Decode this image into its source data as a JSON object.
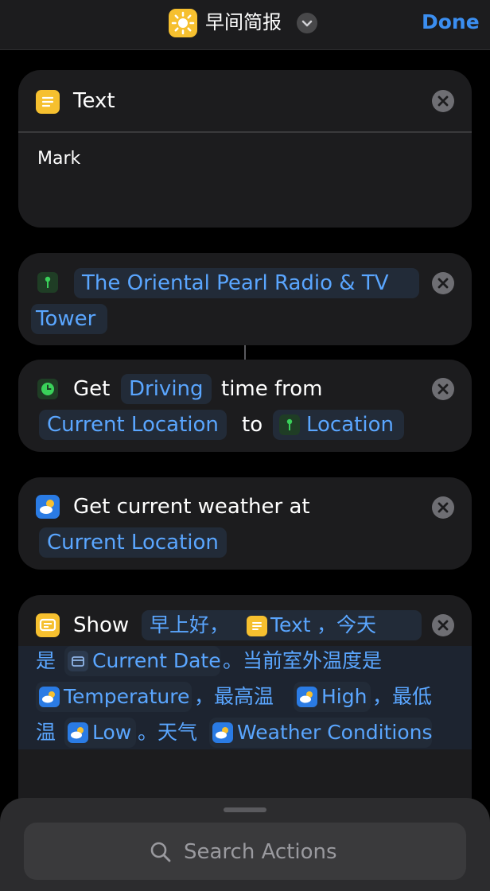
{
  "header": {
    "app_icon": "sun-icon",
    "title": "早间简报",
    "done_label": "Done"
  },
  "actions": {
    "text_action": {
      "icon": "text-doc-icon",
      "title": "Text",
      "body": "Mark"
    },
    "location_action": {
      "icon": "location-pin-icon",
      "value_line1": "The Oriental Pearl Radio & TV",
      "value_line2": "Tower"
    },
    "travel_time_action": {
      "icon": "clock-icon",
      "get": "Get",
      "mode": "Driving",
      "time_from": "time from",
      "from": "Current Location",
      "to": "to",
      "destination": "Location"
    },
    "weather_action": {
      "icon": "weather-icon",
      "label": "Get current weather at",
      "location": "Current Location"
    },
    "show_action": {
      "icon": "speech-bubble-icon",
      "show": "Show",
      "seg1": "早上好，",
      "var_text": "Text",
      "seg2": "，今天",
      "seg3": "是",
      "var_date": "Current Date",
      "seg4": "。当前室外温度是",
      "var_temp": "Temperature",
      "seg5": "，最高温",
      "var_high": "High",
      "seg6": "，最低",
      "seg7": "温",
      "var_low": "Low",
      "seg8": "。天气",
      "var_conditions": "Weather Conditions"
    }
  },
  "search": {
    "icon": "search-icon",
    "placeholder": "Search Actions"
  },
  "colors": {
    "accent": "#3b8ef0",
    "token_text": "#5aa6ff",
    "card_bg": "#1c1c1e",
    "icon_yellow": "#f6c02f"
  }
}
